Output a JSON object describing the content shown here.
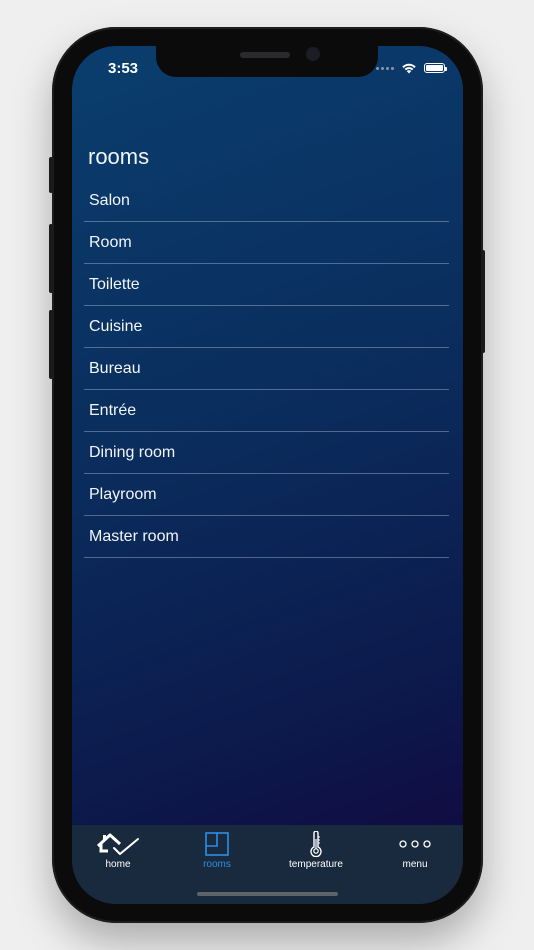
{
  "status_bar": {
    "time": "3:53"
  },
  "header": {
    "title": "rooms"
  },
  "rooms": [
    {
      "label": "Salon"
    },
    {
      "label": "Room"
    },
    {
      "label": "Toilette"
    },
    {
      "label": "Cuisine"
    },
    {
      "label": "Bureau"
    },
    {
      "label": "Entrée"
    },
    {
      "label": "Dining room"
    },
    {
      "label": "Playroom"
    },
    {
      "label": "Master room"
    }
  ],
  "tabbar": {
    "active": "rooms",
    "accent_color": "#2b8ee6",
    "tabs": [
      {
        "label": "home",
        "icon": "house-check-icon"
      },
      {
        "label": "rooms",
        "icon": "floorplan-icon"
      },
      {
        "label": "temperature",
        "icon": "thermometer-icon"
      },
      {
        "label": "menu",
        "icon": "more-dots-icon"
      }
    ]
  }
}
